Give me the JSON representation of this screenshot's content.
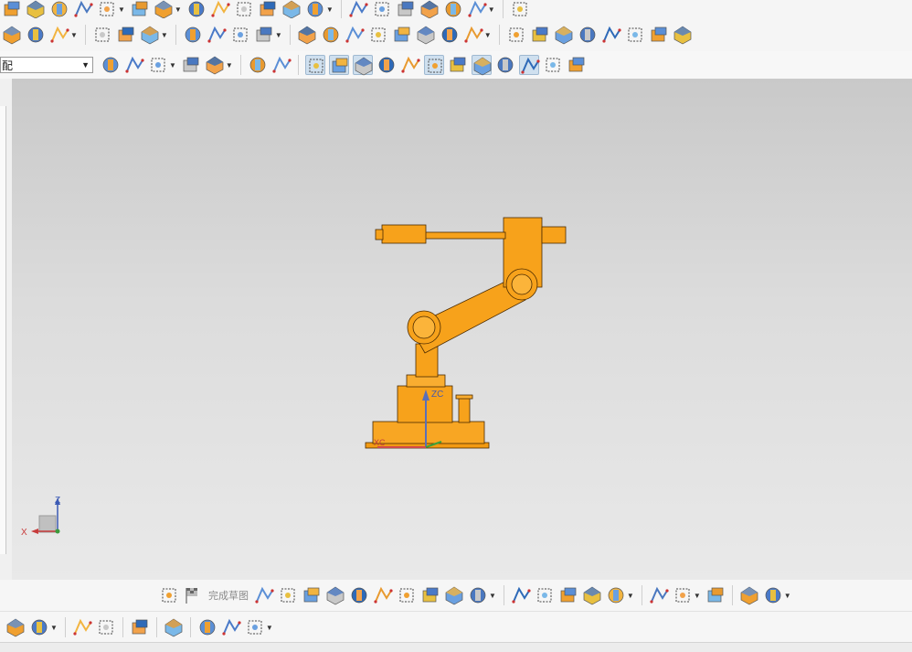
{
  "filter": {
    "value": "配"
  },
  "toolbar3": {
    "dropdown_arrow": "▼"
  },
  "sketch_toolbar": {
    "finish_sketch_label": "完成草图"
  },
  "view_triad": {
    "x_label": "X",
    "z_label": "Z"
  },
  "wcs": {
    "x_label": "XC",
    "z_label": "ZC"
  },
  "icons": {
    "tb1": [
      "surface-icon",
      "block-icon",
      "extrude-icon",
      "hole-array-icon",
      "pattern-icon",
      "shell-icon",
      "face-icon",
      "boolean-icon",
      "chamfer-icon",
      "blend-icon",
      "cylinder-icon",
      "thicken-icon",
      "draft-icon",
      "trim-icon",
      "sweep-icon",
      "mesh-icon",
      "section-icon",
      "studio-surface-icon",
      "curve-network-icon",
      "layer-icon"
    ],
    "tb2": [
      "assembly-icon",
      "component-icon",
      "text-icon",
      "offset-surface-icon",
      "emboss-icon",
      "format-icon",
      "thread-icon",
      "spring-icon",
      "bearing-icon",
      "tolerance-icon",
      "triangle-icon",
      "table-icon",
      "sketch-grid-icon",
      "pattern-face-icon",
      "note-icon",
      "pmi-icon",
      "hole-callout-icon",
      "assembly-constraint-icon",
      "add-component-icon",
      "line-icon",
      "arc-icon",
      "polyline-icon",
      "fillet-curve-icon",
      "project-icon",
      "intersect-icon",
      "offset-curve-icon"
    ],
    "tb3": [
      "select-all-icon",
      "snap-icon",
      "snap-point-icon",
      "snap-end-icon",
      "selection-box-icon",
      "view-solid-icon",
      "view-cube-icon",
      "snap-grid-icon",
      "snap-line-icon",
      "snap-curve-icon",
      "snap-bezier-icon",
      "snap-spline-icon",
      "snap-intersection-icon",
      "snap-center-icon",
      "snap-circle-icon",
      "snap-cross-icon",
      "snap-tangent-icon",
      "snap-face-icon",
      "snap-quadrant-icon"
    ],
    "btm1": [
      "sketch-icon",
      "finish-sketch-icon",
      "profile-icon",
      "line-tool-icon",
      "arc-tool-icon",
      "circle-tool-icon",
      "corner-icon",
      "chamfer-corner-icon",
      "rectangle-icon",
      "studio-spline-icon",
      "point-icon",
      "polygon-icon",
      "trim-icon",
      "extend-icon",
      "make-corner-icon",
      "offset-icon",
      "pattern-icon",
      "mirror-icon",
      "constraint-icon",
      "dimension-icon",
      "show-constraints-icon",
      "convert-icon"
    ],
    "btm2": [
      "constraint-nav-icon",
      "move-component-icon",
      "assembly-array-icon",
      "mate-icon",
      "wave-icon",
      "chain-link-icon",
      "clamp-icon",
      "sequence-icon",
      "exploded-view-icon"
    ]
  }
}
